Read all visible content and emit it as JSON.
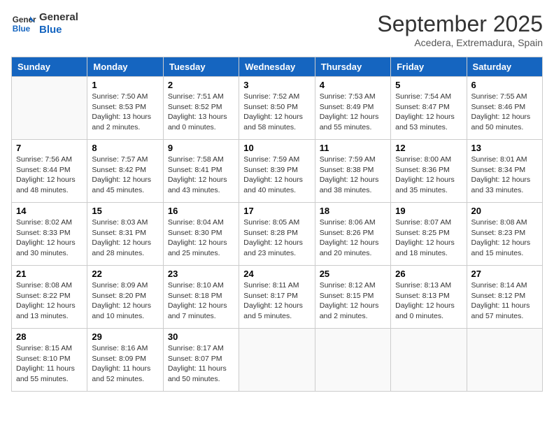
{
  "logo": {
    "line1": "General",
    "line2": "Blue"
  },
  "title": "September 2025",
  "location": "Acedera, Extremadura, Spain",
  "days_of_week": [
    "Sunday",
    "Monday",
    "Tuesday",
    "Wednesday",
    "Thursday",
    "Friday",
    "Saturday"
  ],
  "weeks": [
    [
      {
        "day": "",
        "info": ""
      },
      {
        "day": "1",
        "info": "Sunrise: 7:50 AM\nSunset: 8:53 PM\nDaylight: 13 hours\nand 2 minutes."
      },
      {
        "day": "2",
        "info": "Sunrise: 7:51 AM\nSunset: 8:52 PM\nDaylight: 13 hours\nand 0 minutes."
      },
      {
        "day": "3",
        "info": "Sunrise: 7:52 AM\nSunset: 8:50 PM\nDaylight: 12 hours\nand 58 minutes."
      },
      {
        "day": "4",
        "info": "Sunrise: 7:53 AM\nSunset: 8:49 PM\nDaylight: 12 hours\nand 55 minutes."
      },
      {
        "day": "5",
        "info": "Sunrise: 7:54 AM\nSunset: 8:47 PM\nDaylight: 12 hours\nand 53 minutes."
      },
      {
        "day": "6",
        "info": "Sunrise: 7:55 AM\nSunset: 8:46 PM\nDaylight: 12 hours\nand 50 minutes."
      }
    ],
    [
      {
        "day": "7",
        "info": "Sunrise: 7:56 AM\nSunset: 8:44 PM\nDaylight: 12 hours\nand 48 minutes."
      },
      {
        "day": "8",
        "info": "Sunrise: 7:57 AM\nSunset: 8:42 PM\nDaylight: 12 hours\nand 45 minutes."
      },
      {
        "day": "9",
        "info": "Sunrise: 7:58 AM\nSunset: 8:41 PM\nDaylight: 12 hours\nand 43 minutes."
      },
      {
        "day": "10",
        "info": "Sunrise: 7:59 AM\nSunset: 8:39 PM\nDaylight: 12 hours\nand 40 minutes."
      },
      {
        "day": "11",
        "info": "Sunrise: 7:59 AM\nSunset: 8:38 PM\nDaylight: 12 hours\nand 38 minutes."
      },
      {
        "day": "12",
        "info": "Sunrise: 8:00 AM\nSunset: 8:36 PM\nDaylight: 12 hours\nand 35 minutes."
      },
      {
        "day": "13",
        "info": "Sunrise: 8:01 AM\nSunset: 8:34 PM\nDaylight: 12 hours\nand 33 minutes."
      }
    ],
    [
      {
        "day": "14",
        "info": "Sunrise: 8:02 AM\nSunset: 8:33 PM\nDaylight: 12 hours\nand 30 minutes."
      },
      {
        "day": "15",
        "info": "Sunrise: 8:03 AM\nSunset: 8:31 PM\nDaylight: 12 hours\nand 28 minutes."
      },
      {
        "day": "16",
        "info": "Sunrise: 8:04 AM\nSunset: 8:30 PM\nDaylight: 12 hours\nand 25 minutes."
      },
      {
        "day": "17",
        "info": "Sunrise: 8:05 AM\nSunset: 8:28 PM\nDaylight: 12 hours\nand 23 minutes."
      },
      {
        "day": "18",
        "info": "Sunrise: 8:06 AM\nSunset: 8:26 PM\nDaylight: 12 hours\nand 20 minutes."
      },
      {
        "day": "19",
        "info": "Sunrise: 8:07 AM\nSunset: 8:25 PM\nDaylight: 12 hours\nand 18 minutes."
      },
      {
        "day": "20",
        "info": "Sunrise: 8:08 AM\nSunset: 8:23 PM\nDaylight: 12 hours\nand 15 minutes."
      }
    ],
    [
      {
        "day": "21",
        "info": "Sunrise: 8:08 AM\nSunset: 8:22 PM\nDaylight: 12 hours\nand 13 minutes."
      },
      {
        "day": "22",
        "info": "Sunrise: 8:09 AM\nSunset: 8:20 PM\nDaylight: 12 hours\nand 10 minutes."
      },
      {
        "day": "23",
        "info": "Sunrise: 8:10 AM\nSunset: 8:18 PM\nDaylight: 12 hours\nand 7 minutes."
      },
      {
        "day": "24",
        "info": "Sunrise: 8:11 AM\nSunset: 8:17 PM\nDaylight: 12 hours\nand 5 minutes."
      },
      {
        "day": "25",
        "info": "Sunrise: 8:12 AM\nSunset: 8:15 PM\nDaylight: 12 hours\nand 2 minutes."
      },
      {
        "day": "26",
        "info": "Sunrise: 8:13 AM\nSunset: 8:13 PM\nDaylight: 12 hours\nand 0 minutes."
      },
      {
        "day": "27",
        "info": "Sunrise: 8:14 AM\nSunset: 8:12 PM\nDaylight: 11 hours\nand 57 minutes."
      }
    ],
    [
      {
        "day": "28",
        "info": "Sunrise: 8:15 AM\nSunset: 8:10 PM\nDaylight: 11 hours\nand 55 minutes."
      },
      {
        "day": "29",
        "info": "Sunrise: 8:16 AM\nSunset: 8:09 PM\nDaylight: 11 hours\nand 52 minutes."
      },
      {
        "day": "30",
        "info": "Sunrise: 8:17 AM\nSunset: 8:07 PM\nDaylight: 11 hours\nand 50 minutes."
      },
      {
        "day": "",
        "info": ""
      },
      {
        "day": "",
        "info": ""
      },
      {
        "day": "",
        "info": ""
      },
      {
        "day": "",
        "info": ""
      }
    ]
  ]
}
